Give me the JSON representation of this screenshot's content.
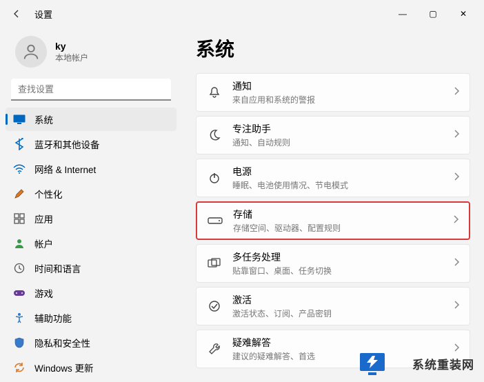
{
  "window": {
    "title": "设置",
    "min": "—",
    "max": "▢",
    "close": "✕"
  },
  "user": {
    "name": "ky",
    "sub": "本地帐户"
  },
  "search": {
    "placeholder": "查找设置"
  },
  "nav": {
    "items": [
      {
        "label": "系统"
      },
      {
        "label": "蓝牙和其他设备"
      },
      {
        "label": "网络 & Internet"
      },
      {
        "label": "个性化"
      },
      {
        "label": "应用"
      },
      {
        "label": "帐户"
      },
      {
        "label": "时间和语言"
      },
      {
        "label": "游戏"
      },
      {
        "label": "辅助功能"
      },
      {
        "label": "隐私和安全性"
      },
      {
        "label": "Windows 更新"
      }
    ]
  },
  "page": {
    "title": "系统"
  },
  "cards": [
    {
      "title": "通知",
      "sub": "来自应用和系统的警报"
    },
    {
      "title": "专注助手",
      "sub": "通知、自动规则"
    },
    {
      "title": "电源",
      "sub": "睡眠、电池使用情况、节电模式"
    },
    {
      "title": "存储",
      "sub": "存储空间、驱动器、配置规则"
    },
    {
      "title": "多任务处理",
      "sub": "贴靠窗口、桌面、任务切换"
    },
    {
      "title": "激活",
      "sub": "激活状态、订阅、产品密钥"
    },
    {
      "title": "疑难解答",
      "sub": "建议的疑难解答、首选"
    }
  ],
  "watermark": {
    "text": "系统重装网"
  }
}
